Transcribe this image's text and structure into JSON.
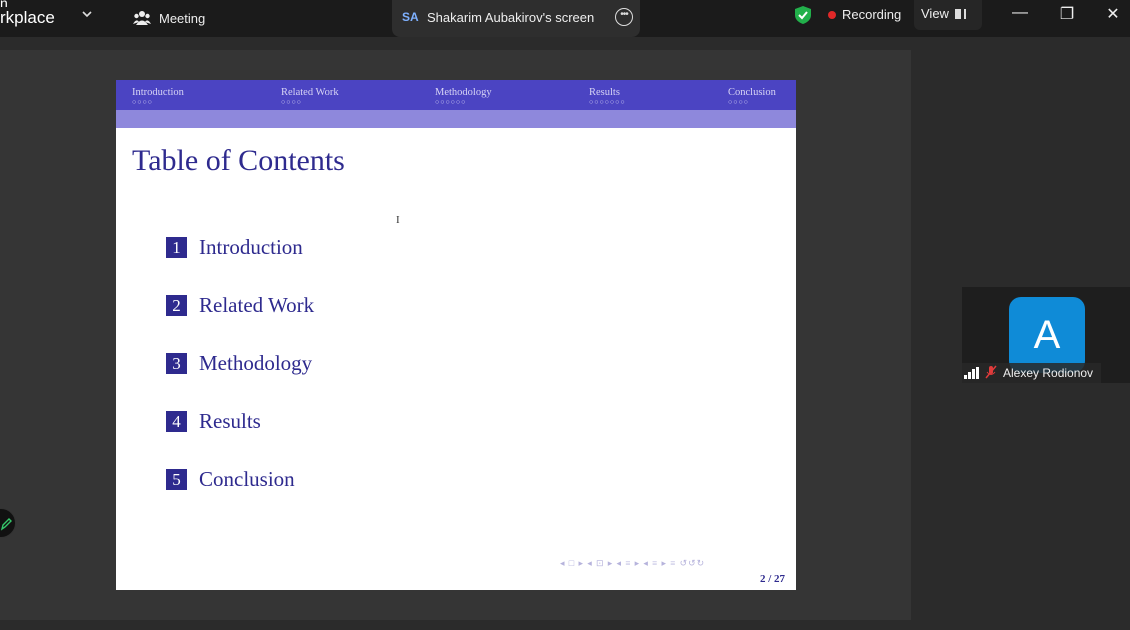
{
  "app": {
    "title_top": "n",
    "title_bottom": "rkplace"
  },
  "toolbar": {
    "meeting_label": "Meeting",
    "share_initials": "SA",
    "share_label": "Shakarim Aubakirov's screen",
    "recording_label": "Recording",
    "view_label": "View",
    "minimize": "—",
    "restore": "❐",
    "close": "✕"
  },
  "slide": {
    "nav_sections": [
      {
        "label": "Introduction",
        "dots": "○○○○"
      },
      {
        "label": "Related Work",
        "dots": "○○○○"
      },
      {
        "label": "Methodology",
        "dots": "○○○○○○"
      },
      {
        "label": "Results",
        "dots": "○○○○○○○"
      },
      {
        "label": "Conclusion",
        "dots": "○○○○"
      }
    ],
    "title": "Table of Contents",
    "toc": [
      {
        "num": "1",
        "label": "Introduction"
      },
      {
        "num": "2",
        "label": "Related Work"
      },
      {
        "num": "3",
        "label": "Methodology"
      },
      {
        "num": "4",
        "label": "Results"
      },
      {
        "num": "5",
        "label": "Conclusion"
      }
    ],
    "controls": "◂ □ ▸ ◂ ⊡ ▸ ◂ ≡ ▸ ◂ ≡ ▸ ≡ ↺↺↻",
    "page": "2 / 27"
  },
  "participant": {
    "initial": "A",
    "name": "Alexey Rodionov"
  },
  "colors": {
    "beamer_primary": "#4b44c2",
    "beamer_secondary": "#8e88dc",
    "avatar": "#0f8bd7",
    "recording": "#e02828"
  }
}
